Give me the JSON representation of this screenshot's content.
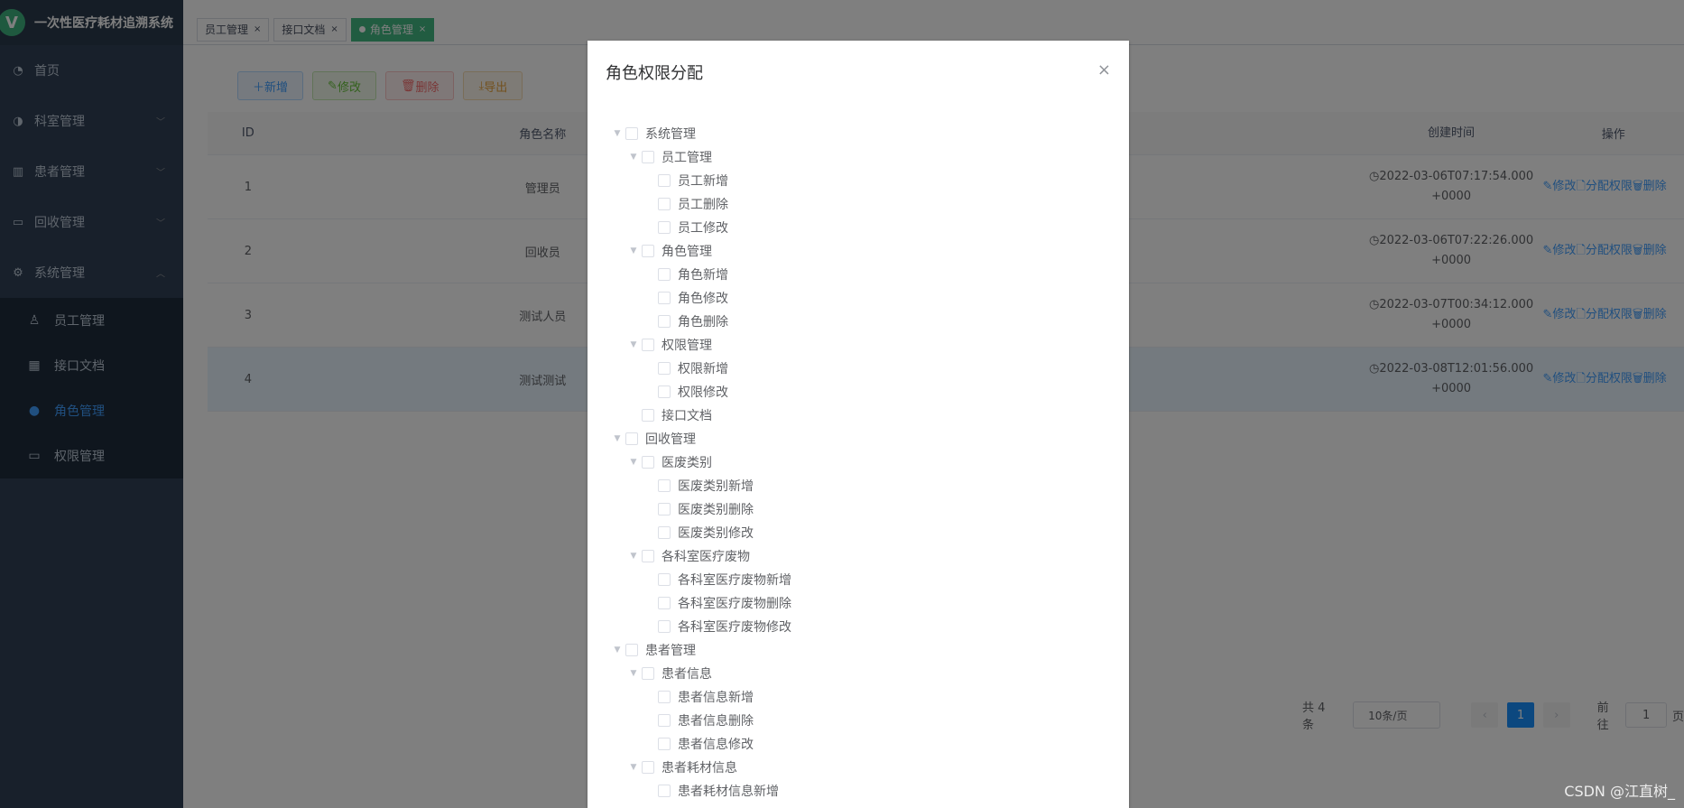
{
  "sidebar": {
    "logo_letter": "V",
    "title": "一次性医疗耗材追溯系统",
    "items": [
      {
        "label": "首页",
        "icon": "dashboard-icon"
      },
      {
        "label": "科室管理",
        "icon": "chart-icon"
      },
      {
        "label": "患者管理",
        "icon": "table-icon"
      },
      {
        "label": "回收管理",
        "icon": "folder-icon"
      },
      {
        "label": "系统管理",
        "icon": "gear-icon"
      }
    ],
    "sub_items": [
      {
        "label": "员工管理",
        "icon": "user-icon"
      },
      {
        "label": "接口文档",
        "icon": "grid-icon"
      },
      {
        "label": "角色管理",
        "icon": "peoples-icon"
      },
      {
        "label": "权限管理",
        "icon": "monitor-icon"
      }
    ]
  },
  "tags": [
    {
      "label": "员工管理"
    },
    {
      "label": "接口文档"
    },
    {
      "label": "角色管理"
    }
  ],
  "toolbar": {
    "add": "新增",
    "edit": "修改",
    "delete": "删除",
    "export": "导出"
  },
  "table": {
    "headers": {
      "id": "ID",
      "name": "角色名称",
      "time": "创建时间",
      "ops": "操作"
    },
    "rows": [
      {
        "id": "1",
        "name": "管理员",
        "time1": "2022-03-06T07:17:54.000",
        "time2": "+0000"
      },
      {
        "id": "2",
        "name": "回收员",
        "time1": "2022-03-06T07:22:26.000",
        "time2": "+0000"
      },
      {
        "id": "3",
        "name": "测试人员",
        "time1": "2022-03-07T00:34:12.000",
        "time2": "+0000"
      },
      {
        "id": "4",
        "name": "测试测试",
        "time1": "2022-03-08T12:01:56.000",
        "time2": "+0000"
      }
    ],
    "op_edit": "修改",
    "op_assign": "分配权限",
    "op_delete": "删除"
  },
  "pagination": {
    "total": "共 4 条",
    "page_size": "10条/页",
    "current": "1",
    "goto_label": "前往",
    "goto_value": "1",
    "page_suffix": "页"
  },
  "dialog": {
    "title": "角色权限分配",
    "close": "×",
    "tree": [
      {
        "label": "系统管理",
        "level": 0,
        "arrow": true
      },
      {
        "label": "员工管理",
        "level": 1,
        "arrow": true
      },
      {
        "label": "员工新增",
        "level": 2,
        "arrow": false
      },
      {
        "label": "员工删除",
        "level": 2,
        "arrow": false
      },
      {
        "label": "员工修改",
        "level": 2,
        "arrow": false
      },
      {
        "label": "角色管理",
        "level": 1,
        "arrow": true
      },
      {
        "label": "角色新增",
        "level": 2,
        "arrow": false
      },
      {
        "label": "角色修改",
        "level": 2,
        "arrow": false
      },
      {
        "label": "角色删除",
        "level": 2,
        "arrow": false
      },
      {
        "label": "权限管理",
        "level": 1,
        "arrow": true
      },
      {
        "label": "权限新增",
        "level": 2,
        "arrow": false
      },
      {
        "label": "权限修改",
        "level": 2,
        "arrow": false
      },
      {
        "label": "接口文档",
        "level": 1,
        "arrow": false
      },
      {
        "label": "回收管理",
        "level": 0,
        "arrow": true
      },
      {
        "label": "医废类别",
        "level": 1,
        "arrow": true
      },
      {
        "label": "医废类别新增",
        "level": 2,
        "arrow": false
      },
      {
        "label": "医废类别删除",
        "level": 2,
        "arrow": false
      },
      {
        "label": "医废类别修改",
        "level": 2,
        "arrow": false
      },
      {
        "label": "各科室医疗废物",
        "level": 1,
        "arrow": true
      },
      {
        "label": "各科室医疗废物新增",
        "level": 2,
        "arrow": false
      },
      {
        "label": "各科室医疗废物删除",
        "level": 2,
        "arrow": false
      },
      {
        "label": "各科室医疗废物修改",
        "level": 2,
        "arrow": false
      },
      {
        "label": "患者管理",
        "level": 0,
        "arrow": true
      },
      {
        "label": "患者信息",
        "level": 1,
        "arrow": true
      },
      {
        "label": "患者信息新增",
        "level": 2,
        "arrow": false
      },
      {
        "label": "患者信息删除",
        "level": 2,
        "arrow": false
      },
      {
        "label": "患者信息修改",
        "level": 2,
        "arrow": false
      },
      {
        "label": "患者耗材信息",
        "level": 1,
        "arrow": true
      },
      {
        "label": "患者耗材信息新增",
        "level": 2,
        "arrow": false
      }
    ]
  },
  "watermark": "CSDN @江直树_"
}
